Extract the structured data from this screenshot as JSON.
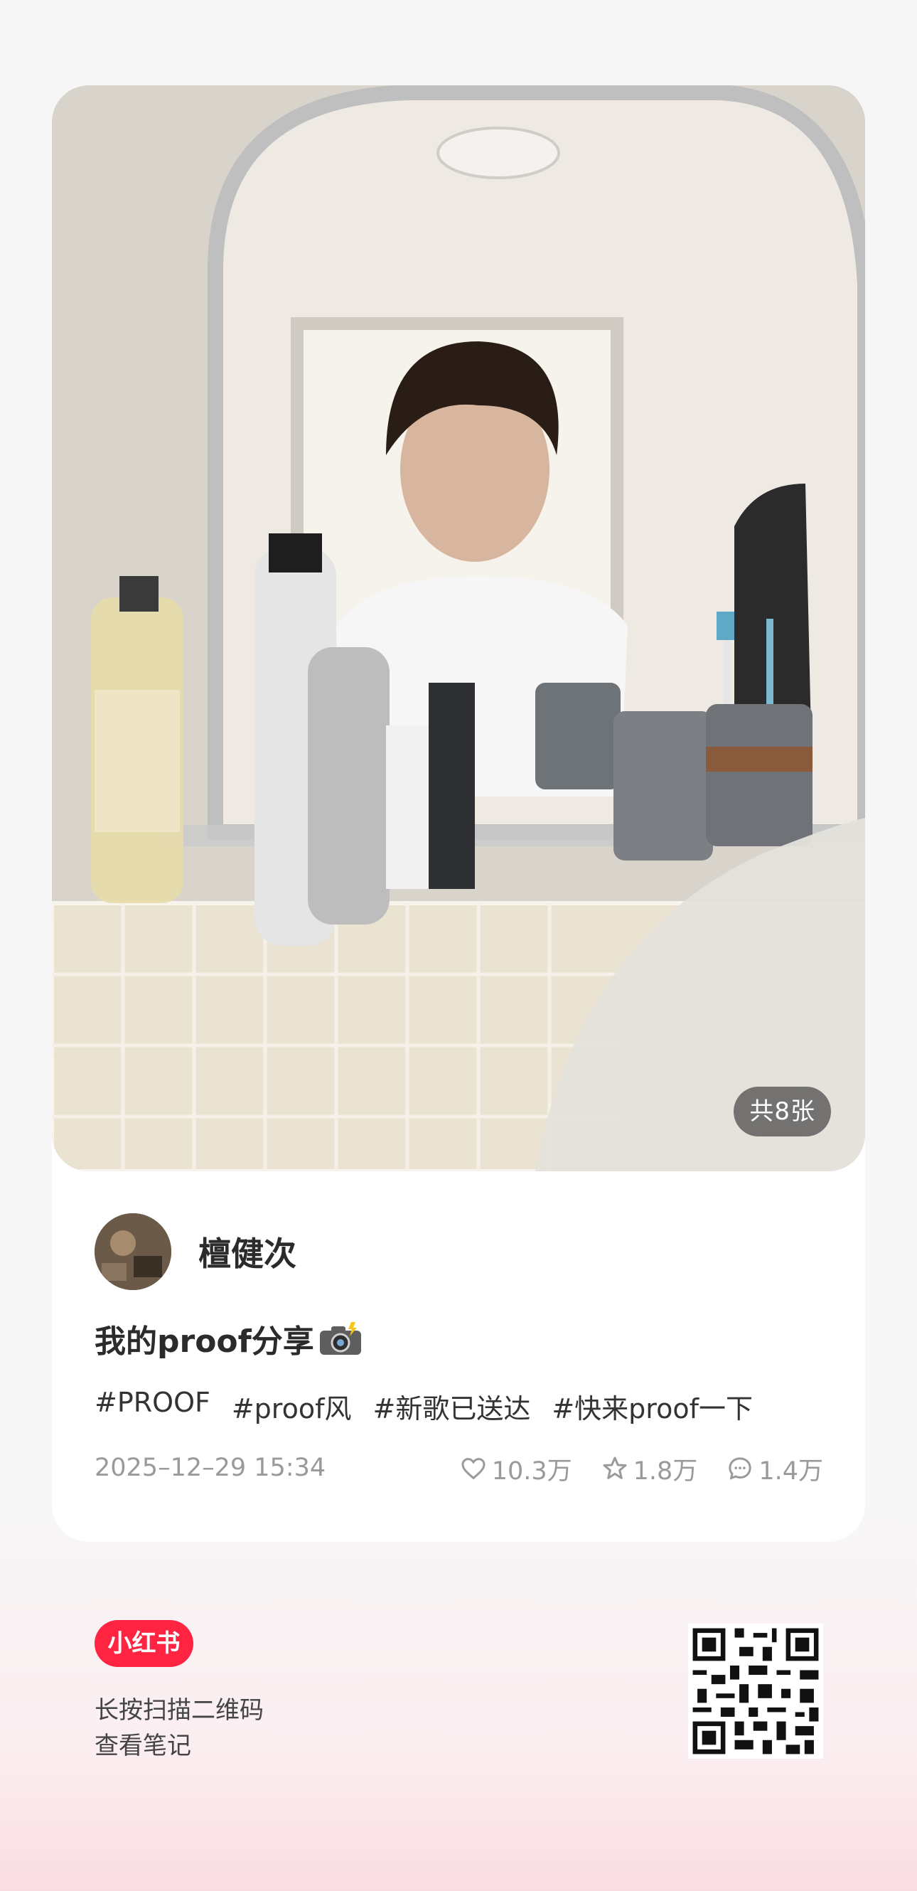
{
  "post": {
    "image_count_badge": "共8张",
    "author": {
      "name": "檀健次"
    },
    "title": "我的proof分享",
    "title_emoji_icon": "camera-flash-icon",
    "tags": [
      "#PROOF",
      "#proof风",
      "#新歌已送达",
      "#快来proof一下"
    ],
    "datetime": "2025–12–29 15:34",
    "stats": {
      "likes": "10.3万",
      "favorites": "1.8万",
      "comments": "1.4万"
    }
  },
  "footer": {
    "logo_text": "小红书",
    "hint_line1": "长按扫描二维码",
    "hint_line2": "查看笔记",
    "qr_icon": "qr-code-icon"
  },
  "colors": {
    "brand_red": "#ff2442",
    "text_primary": "#2b2b2b",
    "text_secondary": "#9a9a9a"
  }
}
